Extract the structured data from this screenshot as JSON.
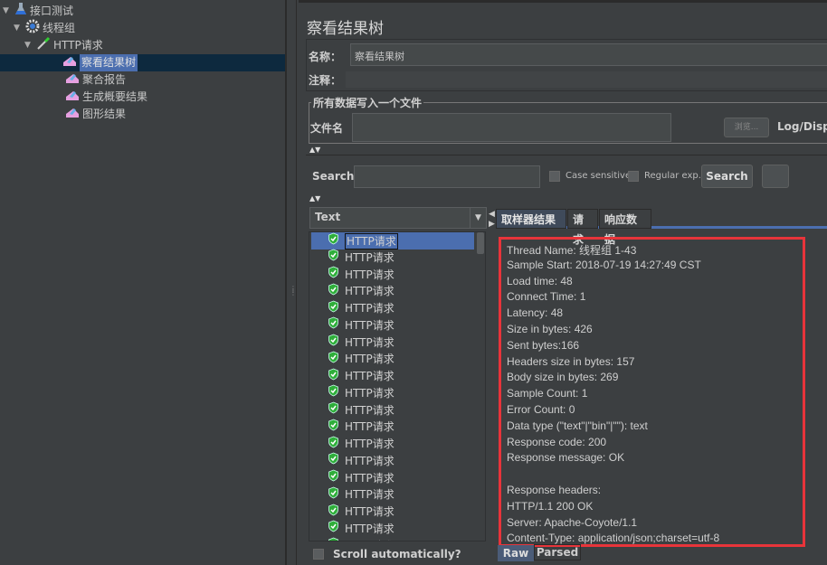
{
  "tree": [
    {
      "label": "接口测试",
      "icon": "flask-icon",
      "depth": 0,
      "expanded": true
    },
    {
      "label": "线程组",
      "icon": "gear-icon",
      "depth": 1,
      "expanded": true
    },
    {
      "label": "HTTP请求",
      "icon": "pipette-icon",
      "depth": 2,
      "expanded": true
    },
    {
      "label": "察看结果树",
      "icon": "listener-chart-icon",
      "depth": 3,
      "selected": true
    },
    {
      "label": "聚合报告",
      "icon": "listener-chart-icon",
      "depth": 3
    },
    {
      "label": "生成概要结果",
      "icon": "listener-chart-icon",
      "depth": 3
    },
    {
      "label": "图形结果",
      "icon": "listener-chart-icon",
      "depth": 3
    }
  ],
  "panel": {
    "title": "察看结果树",
    "name_label": "名称：",
    "name_value": "察看结果树",
    "comment_label": "注释：",
    "comment_value": "",
    "file_section": "所有数据写入一个文件",
    "file_label": "文件名",
    "file_value": "",
    "browse_button": "浏览...",
    "log_display": "Log/Displa"
  },
  "search": {
    "label": "Search:",
    "value": "",
    "case_sensitive": "Case sensitive",
    "regex": "Regular exp.",
    "button": "Search"
  },
  "renderer": {
    "selected": "Text"
  },
  "results": [
    "HTTP请求",
    "HTTP请求",
    "HTTP请求",
    "HTTP请求",
    "HTTP请求",
    "HTTP请求",
    "HTTP请求",
    "HTTP请求",
    "HTTP请求",
    "HTTP请求",
    "HTTP请求",
    "HTTP请求",
    "HTTP请求",
    "HTTP请求",
    "HTTP请求",
    "HTTP请求",
    "HTTP请求",
    "HTTP请求",
    "HTTP请求"
  ],
  "scroll_auto": "Scroll automatically?",
  "tabs": [
    "取样器结果",
    "请求",
    "响应数据"
  ],
  "detail_lines": [
    "Thread Name: 线程组 1-43",
    "Sample Start: 2018-07-19 14:27:49 CST",
    "Load time: 48",
    "Connect Time: 1",
    "Latency: 48",
    "Size in bytes: 426",
    "Sent bytes:166",
    "Headers size in bytes: 157",
    "Body size in bytes: 269",
    "Sample Count: 1",
    "Error Count: 0",
    "Data type (\"text\"|\"bin\"|\"\"): text",
    "Response code: 200",
    "Response message: OK",
    "",
    "Response headers:",
    "HTTP/1.1 200 OK",
    "Server: Apache-Coyote/1.1",
    "Content-Type: application/json;charset=utf-8"
  ],
  "bottom_tabs": [
    "Raw",
    "Parsed"
  ],
  "colors": {
    "background": "#3c3f41",
    "selection": "#4b6eaf",
    "highlight_box": "#e8343a",
    "success": "#2fae3a"
  }
}
